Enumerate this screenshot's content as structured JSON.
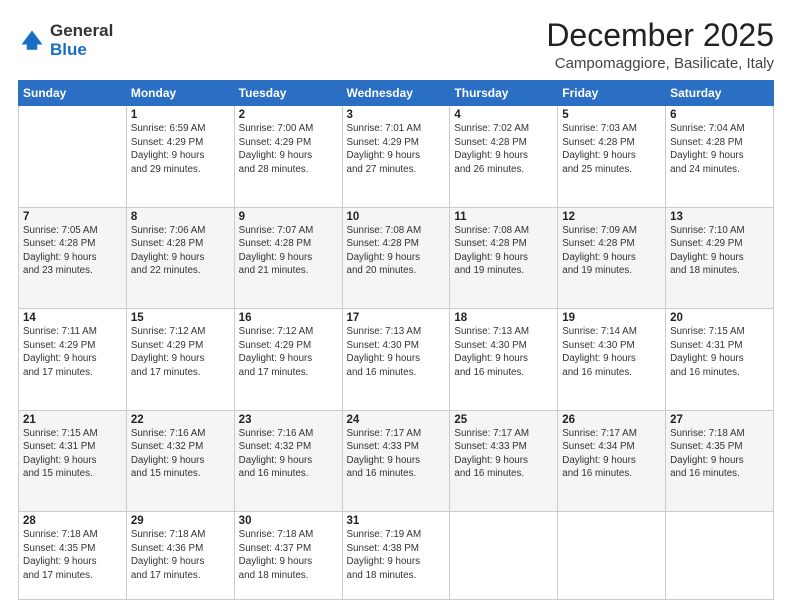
{
  "logo": {
    "general": "General",
    "blue": "Blue"
  },
  "header": {
    "month": "December 2025",
    "location": "Campomaggiore, Basilicate, Italy"
  },
  "weekdays": [
    "Sunday",
    "Monday",
    "Tuesday",
    "Wednesday",
    "Thursday",
    "Friday",
    "Saturday"
  ],
  "weeks": [
    [
      {
        "day": "",
        "info": ""
      },
      {
        "day": "1",
        "info": "Sunrise: 6:59 AM\nSunset: 4:29 PM\nDaylight: 9 hours\nand 29 minutes."
      },
      {
        "day": "2",
        "info": "Sunrise: 7:00 AM\nSunset: 4:29 PM\nDaylight: 9 hours\nand 28 minutes."
      },
      {
        "day": "3",
        "info": "Sunrise: 7:01 AM\nSunset: 4:29 PM\nDaylight: 9 hours\nand 27 minutes."
      },
      {
        "day": "4",
        "info": "Sunrise: 7:02 AM\nSunset: 4:28 PM\nDaylight: 9 hours\nand 26 minutes."
      },
      {
        "day": "5",
        "info": "Sunrise: 7:03 AM\nSunset: 4:28 PM\nDaylight: 9 hours\nand 25 minutes."
      },
      {
        "day": "6",
        "info": "Sunrise: 7:04 AM\nSunset: 4:28 PM\nDaylight: 9 hours\nand 24 minutes."
      }
    ],
    [
      {
        "day": "7",
        "info": "Sunrise: 7:05 AM\nSunset: 4:28 PM\nDaylight: 9 hours\nand 23 minutes."
      },
      {
        "day": "8",
        "info": "Sunrise: 7:06 AM\nSunset: 4:28 PM\nDaylight: 9 hours\nand 22 minutes."
      },
      {
        "day": "9",
        "info": "Sunrise: 7:07 AM\nSunset: 4:28 PM\nDaylight: 9 hours\nand 21 minutes."
      },
      {
        "day": "10",
        "info": "Sunrise: 7:08 AM\nSunset: 4:28 PM\nDaylight: 9 hours\nand 20 minutes."
      },
      {
        "day": "11",
        "info": "Sunrise: 7:08 AM\nSunset: 4:28 PM\nDaylight: 9 hours\nand 19 minutes."
      },
      {
        "day": "12",
        "info": "Sunrise: 7:09 AM\nSunset: 4:28 PM\nDaylight: 9 hours\nand 19 minutes."
      },
      {
        "day": "13",
        "info": "Sunrise: 7:10 AM\nSunset: 4:29 PM\nDaylight: 9 hours\nand 18 minutes."
      }
    ],
    [
      {
        "day": "14",
        "info": "Sunrise: 7:11 AM\nSunset: 4:29 PM\nDaylight: 9 hours\nand 17 minutes."
      },
      {
        "day": "15",
        "info": "Sunrise: 7:12 AM\nSunset: 4:29 PM\nDaylight: 9 hours\nand 17 minutes."
      },
      {
        "day": "16",
        "info": "Sunrise: 7:12 AM\nSunset: 4:29 PM\nDaylight: 9 hours\nand 17 minutes."
      },
      {
        "day": "17",
        "info": "Sunrise: 7:13 AM\nSunset: 4:30 PM\nDaylight: 9 hours\nand 16 minutes."
      },
      {
        "day": "18",
        "info": "Sunrise: 7:13 AM\nSunset: 4:30 PM\nDaylight: 9 hours\nand 16 minutes."
      },
      {
        "day": "19",
        "info": "Sunrise: 7:14 AM\nSunset: 4:30 PM\nDaylight: 9 hours\nand 16 minutes."
      },
      {
        "day": "20",
        "info": "Sunrise: 7:15 AM\nSunset: 4:31 PM\nDaylight: 9 hours\nand 16 minutes."
      }
    ],
    [
      {
        "day": "21",
        "info": "Sunrise: 7:15 AM\nSunset: 4:31 PM\nDaylight: 9 hours\nand 15 minutes."
      },
      {
        "day": "22",
        "info": "Sunrise: 7:16 AM\nSunset: 4:32 PM\nDaylight: 9 hours\nand 15 minutes."
      },
      {
        "day": "23",
        "info": "Sunrise: 7:16 AM\nSunset: 4:32 PM\nDaylight: 9 hours\nand 16 minutes."
      },
      {
        "day": "24",
        "info": "Sunrise: 7:17 AM\nSunset: 4:33 PM\nDaylight: 9 hours\nand 16 minutes."
      },
      {
        "day": "25",
        "info": "Sunrise: 7:17 AM\nSunset: 4:33 PM\nDaylight: 9 hours\nand 16 minutes."
      },
      {
        "day": "26",
        "info": "Sunrise: 7:17 AM\nSunset: 4:34 PM\nDaylight: 9 hours\nand 16 minutes."
      },
      {
        "day": "27",
        "info": "Sunrise: 7:18 AM\nSunset: 4:35 PM\nDaylight: 9 hours\nand 16 minutes."
      }
    ],
    [
      {
        "day": "28",
        "info": "Sunrise: 7:18 AM\nSunset: 4:35 PM\nDaylight: 9 hours\nand 17 minutes."
      },
      {
        "day": "29",
        "info": "Sunrise: 7:18 AM\nSunset: 4:36 PM\nDaylight: 9 hours\nand 17 minutes."
      },
      {
        "day": "30",
        "info": "Sunrise: 7:18 AM\nSunset: 4:37 PM\nDaylight: 9 hours\nand 18 minutes."
      },
      {
        "day": "31",
        "info": "Sunrise: 7:19 AM\nSunset: 4:38 PM\nDaylight: 9 hours\nand 18 minutes."
      },
      {
        "day": "",
        "info": ""
      },
      {
        "day": "",
        "info": ""
      },
      {
        "day": "",
        "info": ""
      }
    ]
  ]
}
